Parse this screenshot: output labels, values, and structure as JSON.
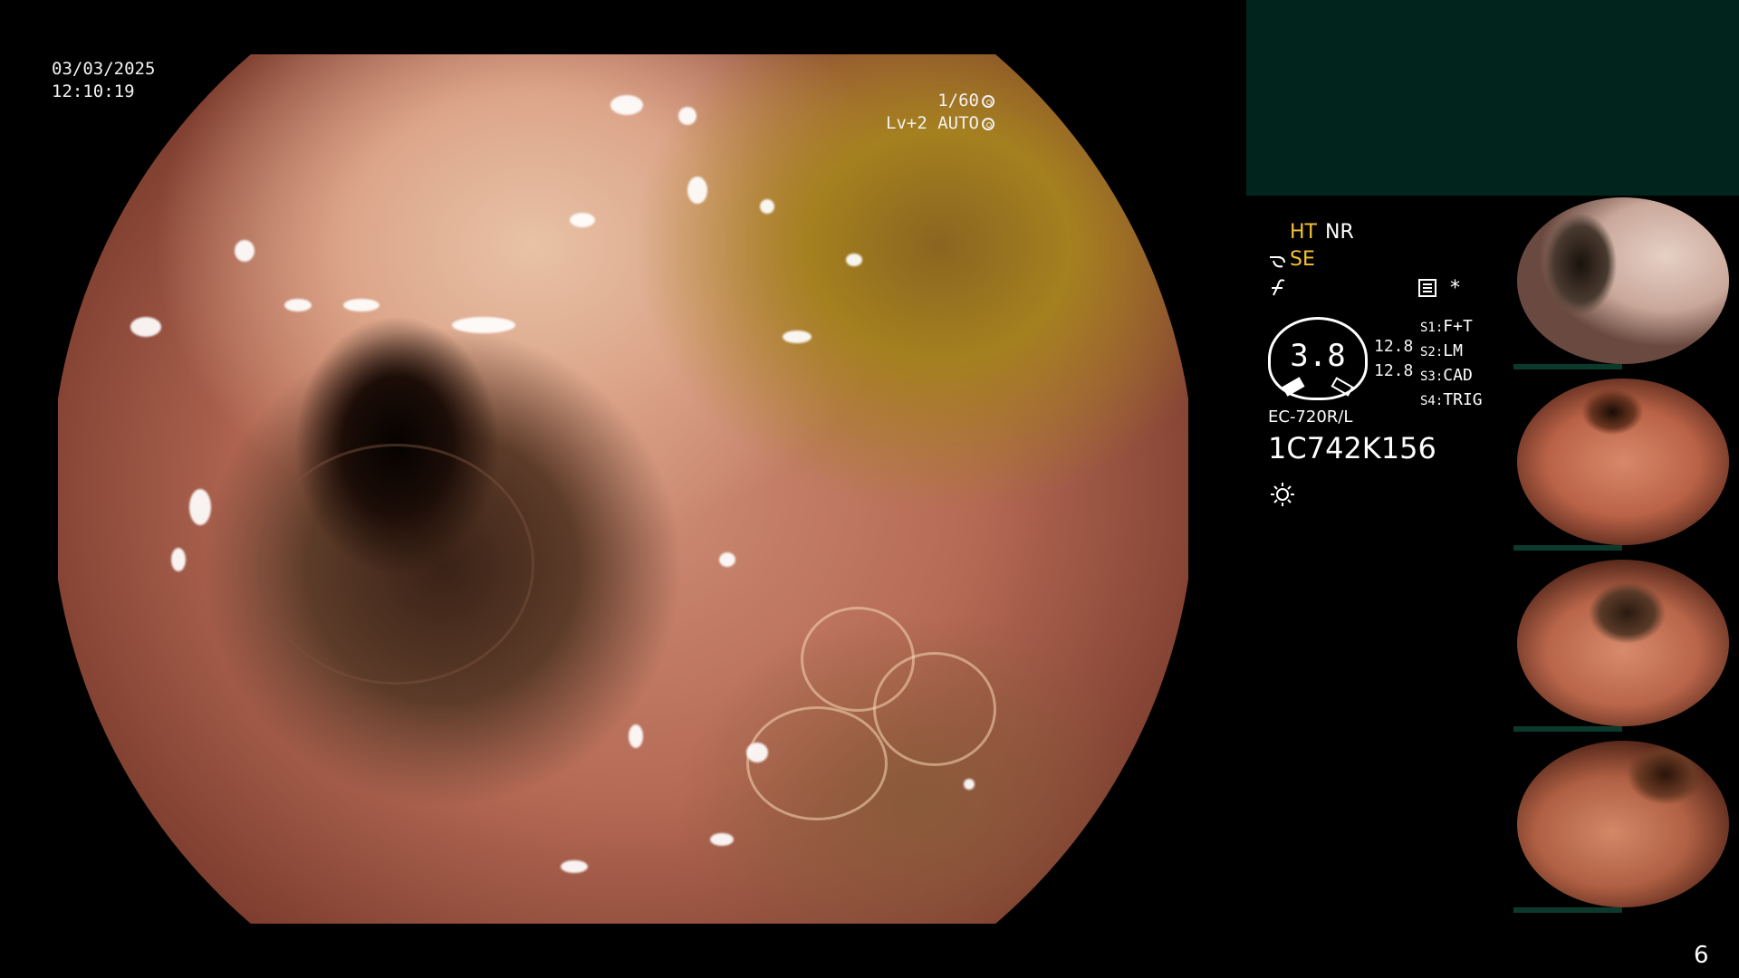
{
  "overlay": {
    "date": "03/03/2025",
    "time": "12:10:19",
    "shutter": "1/60",
    "level": "Lv+2 AUTO"
  },
  "panel": {
    "ht": "HT",
    "nr": "NR",
    "se": "SE",
    "gauge_value": "3.8",
    "value_1": "12.8",
    "value_2": "12.8",
    "s1_label": "S1:",
    "s1_value": "F+T",
    "s2_label": "S2:",
    "s2_value": "LM",
    "s3_label": "S3:",
    "s3_value": "CAD",
    "s4_label": "S4:",
    "s4_value": "TRIG",
    "asterisk": "*",
    "scope_model": "EC-720R/L",
    "serial": "1C742K156",
    "page_number": "6"
  },
  "colors": {
    "accent_yellow": "#f7c232",
    "panel_teal": "#01241c"
  },
  "icons": [
    "shutter-icon",
    "auto-iris-icon",
    "hook-icon",
    "flicker-icon",
    "memo-icon",
    "brightness-icon"
  ]
}
